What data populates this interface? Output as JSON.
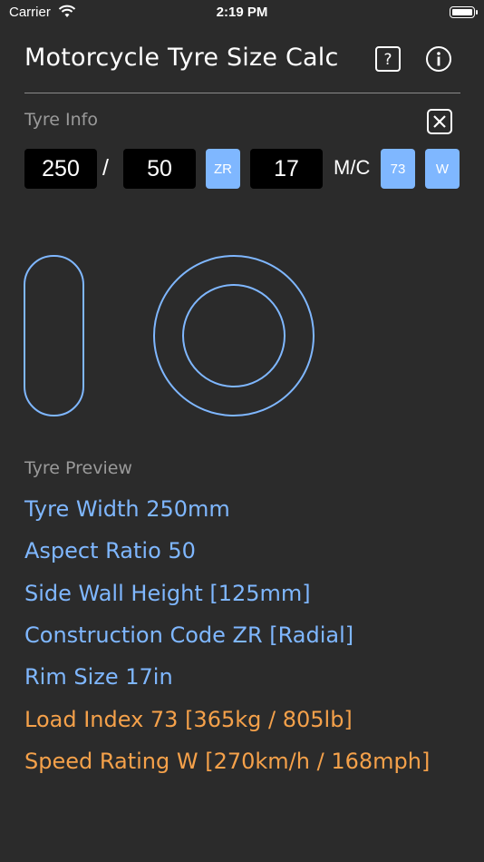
{
  "status_bar": {
    "carrier": "Carrier",
    "time": "2:19 PM"
  },
  "header": {
    "title": "Motorcycle Tyre Size Calc"
  },
  "tyre_info": {
    "label": "Tyre Info",
    "width": "250",
    "separator": "/",
    "aspect": "50",
    "construction": "ZR",
    "rim": "17",
    "suffix": "M/C",
    "load_index": "73",
    "speed_rating": "W"
  },
  "preview": {
    "label": "Tyre Preview",
    "lines": [
      "Tyre Width 250mm",
      "Aspect Ratio 50",
      "Side Wall Height [125mm]",
      "Construction Code ZR [Radial]",
      "Rim Size 17in",
      "Load Index 73 [365kg / 805lb]",
      "Speed Rating W [270km/h / 168mph]"
    ]
  },
  "colors": {
    "accent_blue": "#7fb7ff",
    "accent_orange": "#f5a14a",
    "background": "#2b2b2b"
  },
  "icons": [
    "wifi-icon",
    "battery-icon",
    "help-icon",
    "info-icon",
    "close-icon"
  ]
}
